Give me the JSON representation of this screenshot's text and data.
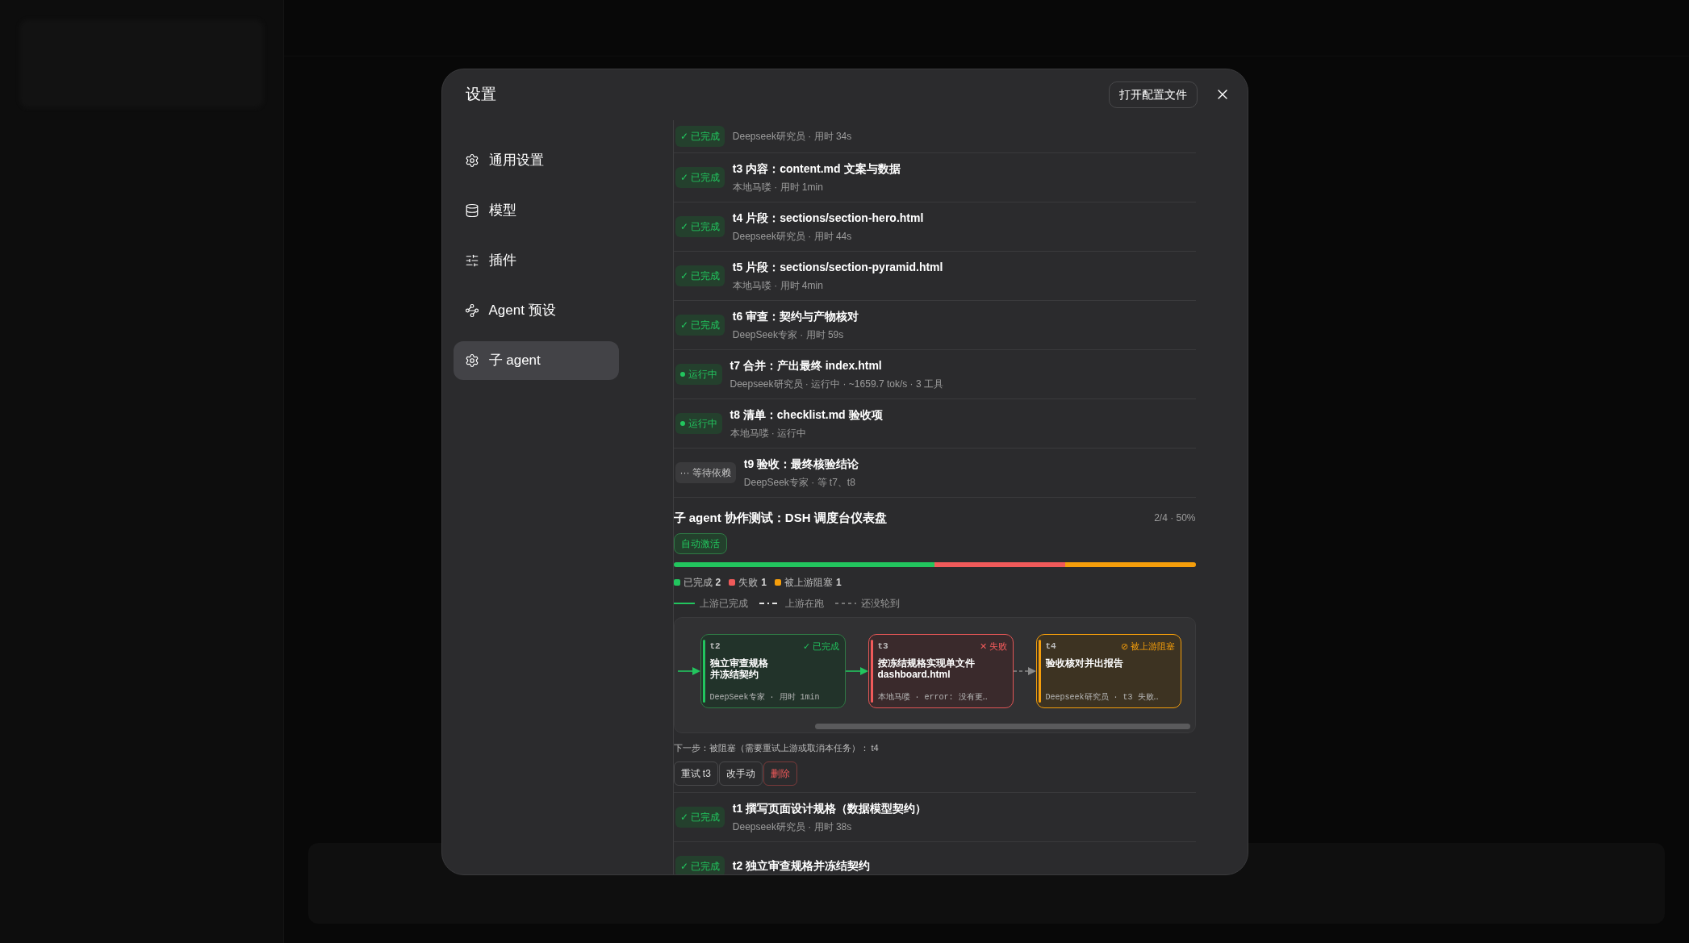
{
  "dialog": {
    "title": "设置",
    "open_config_button": "打开配置文件"
  },
  "nav": [
    {
      "label": "通用设置",
      "selected": false
    },
    {
      "label": "模型",
      "selected": false
    },
    {
      "label": "插件",
      "selected": false
    },
    {
      "label": "Agent 预设",
      "selected": false
    },
    {
      "label": "子 agent",
      "selected": true
    }
  ],
  "tasks_top": [
    {
      "kind": "done",
      "badge": "✓ 已完成",
      "subtitle": "Deepseek研究员 · 用时 34s"
    },
    {
      "kind": "done",
      "badge": "✓ 已完成",
      "title": "t3 内容：content.md 文案与数据",
      "subtitle": "本地马喽 · 用时 1min"
    },
    {
      "kind": "done",
      "badge": "✓ 已完成",
      "title": "t4 片段：sections/section-hero.html",
      "subtitle": "Deepseek研究员 · 用时 44s"
    },
    {
      "kind": "done",
      "badge": "✓ 已完成",
      "title": "t5 片段：sections/section-pyramid.html",
      "subtitle": "本地马喽 · 用时 4min"
    },
    {
      "kind": "done",
      "badge": "✓ 已完成",
      "title": "t6 审查：契约与产物核对",
      "subtitle": "DeepSeek专家 · 用时 59s"
    },
    {
      "kind": "running",
      "badge": "运行中",
      "title": "t7 合并：产出最终 index.html",
      "subtitle": "Deepseek研究员 · 运行中 · ~1659.7 tok/s · 3 工具"
    },
    {
      "kind": "running",
      "badge": "运行中",
      "title": "t8 清单：checklist.md 验收项",
      "subtitle": "本地马喽 · 运行中"
    },
    {
      "kind": "waiting",
      "badge": "··· 等待依赖",
      "title": "t9 验收：最终核验结论",
      "subtitle": "DeepSeek专家 · 等 t7、t8"
    }
  ],
  "group": {
    "title": "子 agent 协作测试：DSH 调度台仪表盘",
    "progress_text": "2/4 · 50%",
    "auto_badge": "自动激活",
    "progress": {
      "level": 0.5
    },
    "legend": [
      {
        "kind": "done",
        "label": "已完成",
        "count": "2"
      },
      {
        "kind": "failed",
        "label": "失败",
        "count": "1"
      },
      {
        "kind": "blocked",
        "label": "被上游阻塞",
        "count": "1"
      }
    ],
    "line_legend": [
      {
        "kind": "solid",
        "label": "上游已完成"
      },
      {
        "kind": "dash_dot",
        "label": "上游在跑"
      },
      {
        "kind": "dashed",
        "label": "还没轮到"
      }
    ],
    "nodes": [
      {
        "kind": "done",
        "label": "t2",
        "state": "✓ 已完成",
        "title_lines": [
          "独立审查规格",
          "并冻结契约"
        ],
        "footer": "DeepSeek专家 · 用时 1min"
      },
      {
        "kind": "failed",
        "label": "t3",
        "state": "✕ 失败",
        "title_lines": [
          "按冻结规格实现单文件",
          "dashboard.html"
        ],
        "footer": "本地马喽 · error: 没有更…"
      },
      {
        "kind": "blocked",
        "label": "t4",
        "state": "⊘ 被上游阻塞",
        "title_lines": [
          "验收核对并出报告"
        ],
        "footer": "Deepseek研究员 · t3 失败…"
      }
    ],
    "edges": [
      {
        "kind": "solid"
      },
      {
        "kind": "solid"
      },
      {
        "kind": "dashed"
      }
    ],
    "next_step": "下一步：被阻塞（需要重试上游或取消本任务）： t4",
    "actions": [
      {
        "label": "重试 t3",
        "kind": "normal"
      },
      {
        "label": "改手动",
        "kind": "normal"
      },
      {
        "label": "删除",
        "kind": "danger"
      }
    ]
  },
  "tasks_bottom": [
    {
      "kind": "done",
      "badge": "✓ 已完成",
      "title": "t1 撰写页面设计规格（数据模型契约）",
      "subtitle": "Deepseek研究员 · 用时 38s"
    },
    {
      "kind": "done",
      "badge": "✓ 已完成",
      "title": "t2 独立审查规格并冻结契约"
    }
  ]
}
